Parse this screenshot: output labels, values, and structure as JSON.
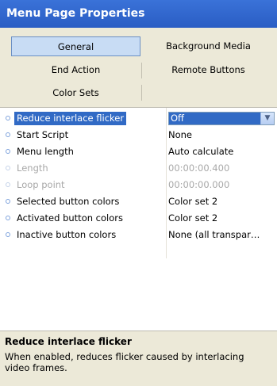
{
  "panel": {
    "title": "Menu Page Properties"
  },
  "tabs": [
    {
      "label": "General",
      "selected": true
    },
    {
      "label": "Background Media"
    },
    {
      "label": "End Action"
    },
    {
      "label": "Remote Buttons"
    },
    {
      "label": "Color Sets"
    }
  ],
  "properties": [
    {
      "name": "Reduce interlace flicker",
      "value": "Off",
      "selected": true,
      "editor": "dropdown"
    },
    {
      "name": "Start Script",
      "value": "None"
    },
    {
      "name": "Menu length",
      "value": "Auto calculate"
    },
    {
      "name": "Length",
      "value": "00:00:00.400",
      "disabled": true
    },
    {
      "name": "Loop point",
      "value": "00:00:00.000",
      "disabled": true
    },
    {
      "name": "Selected button colors",
      "value": "Color set 2"
    },
    {
      "name": "Activated button colors",
      "value": "Color set 2"
    },
    {
      "name": "Inactive button colors",
      "value": "None (all transpar…"
    }
  ],
  "description": {
    "title": "Reduce interlace flicker",
    "text": "When enabled, reduces flicker caused by interlacing video frames."
  },
  "icons": {
    "dropdown": "chevron-down-icon",
    "bullet": "property-bullet-icon"
  },
  "colors": {
    "title_bar": "#2c62c8",
    "selection": "#316ac5",
    "tab_selected": "#c8dcf4",
    "panel_bg": "#ece9d8"
  }
}
